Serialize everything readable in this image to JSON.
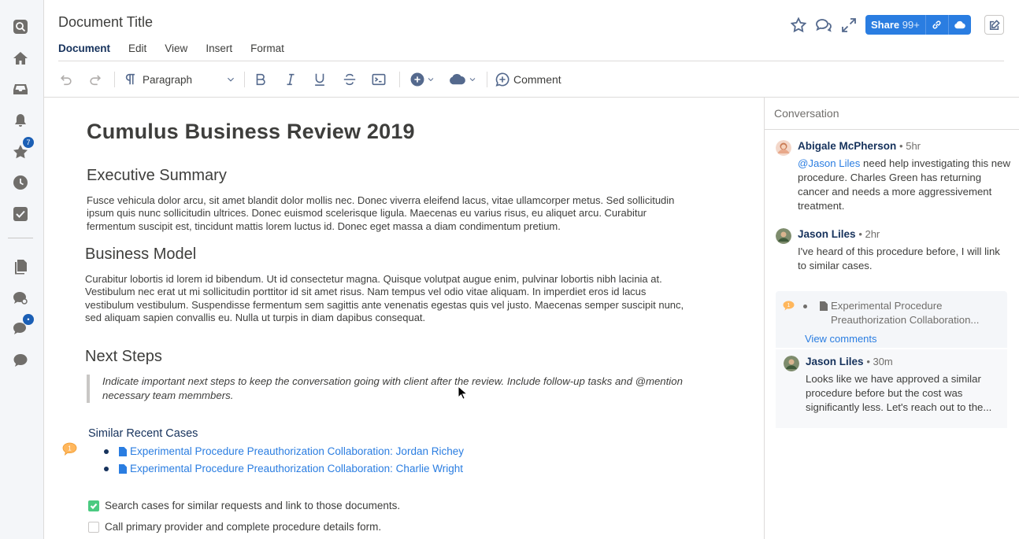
{
  "rail": {
    "favorites_badge": "7",
    "chat_badge": "•"
  },
  "header": {
    "doc_title": "Document Title",
    "menu": [
      "Document",
      "Edit",
      "View",
      "Insert",
      "Format"
    ],
    "share_label": "Share",
    "share_count": "99+"
  },
  "toolbar": {
    "paragraph_label": "Paragraph",
    "comment_label": "Comment"
  },
  "document": {
    "title": "Cumulus Business Review 2019",
    "sections": [
      {
        "heading": "Executive Summary",
        "body": "Fusce vehicula dolor arcu, sit amet blandit dolor mollis nec. Donec viverra eleifend lacus, vitae ullamcorper metus. Sed sollicitudin ipsum quis nunc sollicitudin ultrices. Donec euismod scelerisque ligula. Maecenas eu varius risus, eu aliquet arcu. Curabitur fermentum suscipit est, tincidunt mattis lorem luctus id. Donec eget massa a diam condimentum pretium."
      },
      {
        "heading": "Business Model",
        "body": "Curabitur lobortis id lorem id bibendum. Ut id consectetur magna. Quisque volutpat augue enim, pulvinar lobortis nibh lacinia at. Vestibulum nec erat ut mi sollicitudin porttitor id sit amet risus. Nam tempus vel odio vitae aliquam. In imperdiet eros id lacus vestibulum vestibulum. Suspendisse fermentum sem sagittis ante venenatis egestas quis vel justo. Maecenas semper suscipit nunc, sed aliquam sapien convallis eu. Nulla ut turpis in diam dapibus consequat."
      },
      {
        "heading": "Next Steps",
        "quote": "Indicate important next steps to keep the conversation going with client after the review. Include follow-up tasks and @mention necessary team memmbers."
      }
    ],
    "similar_heading": "Similar Recent Cases",
    "comment_count": "1",
    "cases": [
      "Experimental Procedure Preauthorization Collaboration: Jordan Richey",
      "Experimental Procedure Preauthorization Collaboration: Charlie Wright"
    ],
    "tasks": [
      {
        "label": "Search cases for similar requests and link to those documents.",
        "checked": true
      },
      {
        "label": "Call primary provider and complete procedure details form.",
        "checked": false
      }
    ]
  },
  "conversation": {
    "title": "Conversation",
    "messages": [
      {
        "author": "Abigale McPherson",
        "time": "• 5hr",
        "mention": "@Jason Liles",
        "body": " need help investigating this new procedure. Charles Green has returning cancer and needs a more aggressivement treatment."
      },
      {
        "author": "Jason Liles",
        "time": "• 2hr",
        "body": "I've heard of this procedure before, I will link to similar cases."
      }
    ],
    "thread": {
      "count": "1",
      "title": "Experimental Procedure Preauthorization Collaboration...",
      "view_comments": "View comments",
      "reply": {
        "author": "Jason Liles",
        "time": "• 30m",
        "body": "Looks like we have approved a similar procedure before but the cost was significantly less. Let's reach out to the..."
      }
    }
  },
  "colors": {
    "accent": "#2a7de1",
    "rail_bg": "#f4f6f9",
    "check_green": "#4bca81",
    "comment_badge": "#ffb75d"
  }
}
